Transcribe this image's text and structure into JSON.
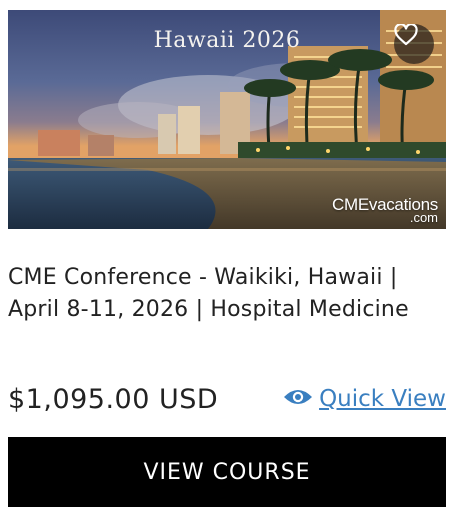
{
  "product": {
    "image_title": "Hawaii 2026",
    "image_alt": "Waikiki beach at night with hotels and palm trees",
    "watermark_main": "CMEvacations",
    "watermark_sub": ".com",
    "title": "CME Conference - Waikiki, Hawaii | April 8-11, 2026 | Hospital Medicine",
    "price": "$1,095.00 USD",
    "quick_view_label": "Quick View",
    "cta_label": "VIEW COURSE"
  },
  "icons": {
    "favorite": "heart-outline-icon",
    "quick_view": "eye-icon"
  },
  "colors": {
    "link": "#3a7fc0",
    "cta_background": "#000000",
    "cta_text": "#ffffff"
  }
}
